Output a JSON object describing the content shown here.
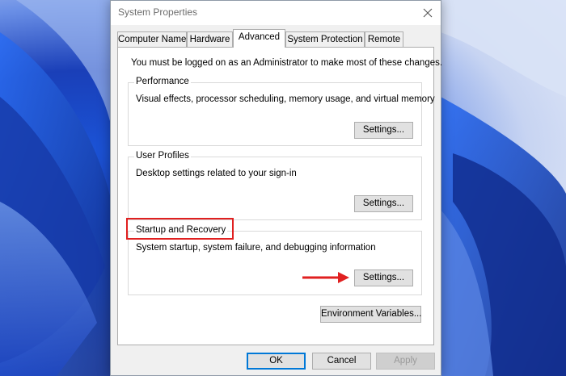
{
  "window": {
    "title": "System Properties"
  },
  "tabs": [
    {
      "label": "Computer Name",
      "active": false
    },
    {
      "label": "Hardware",
      "active": false
    },
    {
      "label": "Advanced",
      "active": true
    },
    {
      "label": "System Protection",
      "active": false
    },
    {
      "label": "Remote",
      "active": false
    }
  ],
  "advanced": {
    "admin_note": "You must be logged on as an Administrator to make most of these changes.",
    "performance": {
      "label": "Performance",
      "description": "Visual effects, processor scheduling, memory usage, and virtual memory",
      "button": "Settings..."
    },
    "user_profiles": {
      "label": "User Profiles",
      "description": "Desktop settings related to your sign-in",
      "button": "Settings..."
    },
    "startup_recovery": {
      "label": "Startup and Recovery",
      "description": "System startup, system failure, and debugging information",
      "button": "Settings..."
    },
    "env_button": "Environment Variables..."
  },
  "footer": {
    "ok": "OK",
    "cancel": "Cancel",
    "apply": "Apply"
  },
  "icons": {
    "close": "close-icon",
    "arrow": "arrow-right-icon"
  },
  "colors": {
    "annotation": "#e02020",
    "dialog_bg": "#f0f0f0",
    "default_button_border": "#0078d7"
  }
}
